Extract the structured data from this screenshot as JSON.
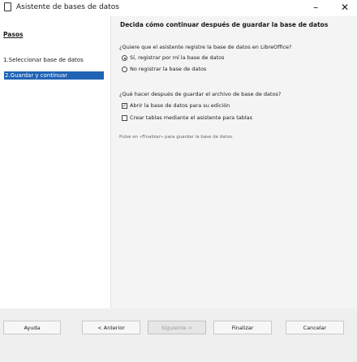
{
  "window": {
    "title": "Asistente de bases de datos",
    "minimize_glyph": "–",
    "close_glyph": "✕"
  },
  "sidebar": {
    "title": "Pasos",
    "items": [
      {
        "label": "1.Seleccionar base de datos"
      },
      {
        "label": "2.Guardar y continuar"
      }
    ]
  },
  "main": {
    "heading": "Decida cómo continuar después de guardar la base de datos",
    "question1": "¿Quiere que el asistente registre la base de datos en LibreOffice?",
    "options": [
      {
        "label": "Sí, registrar por mí la base de datos",
        "selected": true
      },
      {
        "label": "No registrar la base de datos",
        "selected": false
      }
    ],
    "question2": "¿Qué hacer después de guardar el archivo de base de datos?",
    "checks": [
      {
        "label": "Abrir la base de datos para su edición",
        "checked": true
      },
      {
        "label": "Crear tablas mediante el asistente para tablas",
        "checked": false
      }
    ],
    "info": "Pulse en «Finalizar» para guardar la base de datos."
  },
  "footer": {
    "help": "Ayuda",
    "back": "< Anterior",
    "next": "Siguiente >",
    "finish": "Finalizar",
    "cancel": "Cancelar"
  }
}
